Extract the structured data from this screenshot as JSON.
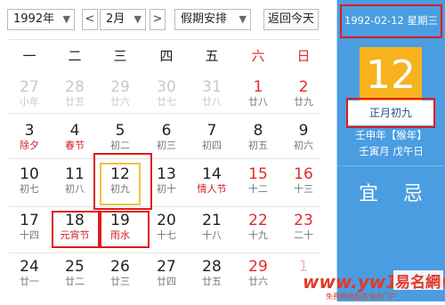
{
  "toolbar": {
    "year_select": "1992年",
    "prev_arrow": "<",
    "month_select": "2月",
    "next_arrow": ">",
    "holiday_select": "假期安排",
    "today_button": "返回今天"
  },
  "weekdays": [
    "一",
    "二",
    "三",
    "四",
    "五",
    "六",
    "日"
  ],
  "weeks": [
    [
      {
        "d": "27",
        "l": "小年",
        "other": true
      },
      {
        "d": "28",
        "l": "廿五",
        "other": true
      },
      {
        "d": "29",
        "l": "廿六",
        "other": true
      },
      {
        "d": "30",
        "l": "廿七",
        "other": true
      },
      {
        "d": "31",
        "l": "廿八",
        "other": true
      },
      {
        "d": "1",
        "l": "廿八",
        "wk": true
      },
      {
        "d": "2",
        "l": "廿九",
        "wk": true
      }
    ],
    [
      {
        "d": "3",
        "l": "除夕",
        "fest": true
      },
      {
        "d": "4",
        "l": "春节",
        "fest": true
      },
      {
        "d": "5",
        "l": "初二"
      },
      {
        "d": "6",
        "l": "初三"
      },
      {
        "d": "7",
        "l": "初四"
      },
      {
        "d": "8",
        "l": "初五"
      },
      {
        "d": "9",
        "l": "初六"
      }
    ],
    [
      {
        "d": "10",
        "l": "初七"
      },
      {
        "d": "11",
        "l": "初八"
      },
      {
        "d": "12",
        "l": "初九",
        "sel": true
      },
      {
        "d": "13",
        "l": "初十"
      },
      {
        "d": "14",
        "l": "情人节",
        "fest": true
      },
      {
        "d": "15",
        "l": "十二",
        "wk": true
      },
      {
        "d": "16",
        "l": "十三",
        "wk": true
      }
    ],
    [
      {
        "d": "17",
        "l": "十四"
      },
      {
        "d": "18",
        "l": "元宵节",
        "fest": true
      },
      {
        "d": "19",
        "l": "雨水",
        "fest": true
      },
      {
        "d": "20",
        "l": "十七"
      },
      {
        "d": "21",
        "l": "十八"
      },
      {
        "d": "22",
        "l": "十九",
        "wk": true
      },
      {
        "d": "23",
        "l": "二十",
        "wk": true
      }
    ],
    [
      {
        "d": "24",
        "l": "廿一"
      },
      {
        "d": "25",
        "l": "廿二"
      },
      {
        "d": "26",
        "l": "廿三"
      },
      {
        "d": "27",
        "l": "廿四"
      },
      {
        "d": "28",
        "l": "廿五"
      },
      {
        "d": "29",
        "l": "廿六",
        "wk": true
      },
      {
        "d": "1",
        "l": "",
        "other": true,
        "wk": true
      }
    ]
  ],
  "side": {
    "date_line": "1992-02-12 星期三",
    "big_day": "12",
    "lunar": "正月初九",
    "ganzhi1": "壬申年【猴年】",
    "ganzhi2": "壬寅月 戊午日",
    "yi": "宜",
    "ji": "忌"
  },
  "watermark": {
    "site": "易名網",
    "url": "www.yw11.com",
    "slogan": "免费网易起名测名门户"
  },
  "colors": {
    "accent_blue": "#4a9de0",
    "highlight_gold": "#f7b21d",
    "weekend_red": "#e02a2a",
    "annotation_red": "#e01a1a"
  }
}
